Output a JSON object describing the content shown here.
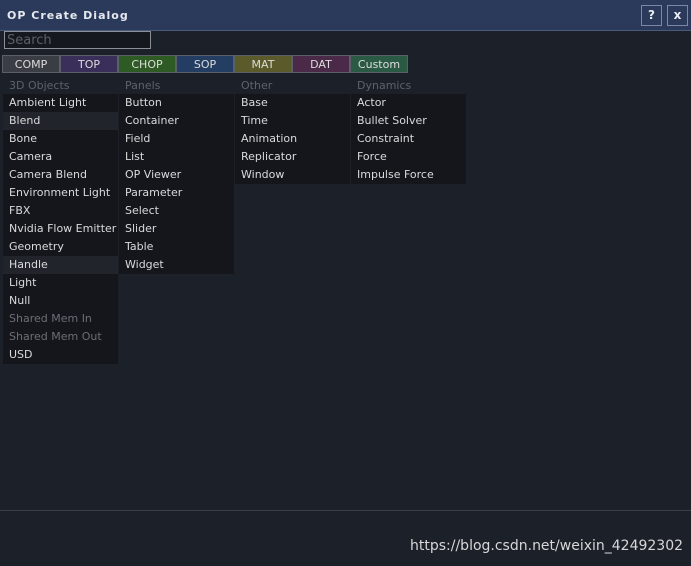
{
  "window": {
    "title": "OP Create Dialog",
    "help_label": "?",
    "close_label": "x"
  },
  "search": {
    "placeholder": "Search",
    "value": ""
  },
  "tabs": [
    {
      "label": "COMP",
      "color": "#3a3d44"
    },
    {
      "label": "TOP",
      "color": "#3a2e5a"
    },
    {
      "label": "CHOP",
      "color": "#2e5a24"
    },
    {
      "label": "SOP",
      "color": "#233e62"
    },
    {
      "label": "MAT",
      "color": "#5a5a2a"
    },
    {
      "label": "DAT",
      "color": "#4a2a48"
    },
    {
      "label": "Custom",
      "color": "#2a5a44"
    }
  ],
  "columns": [
    {
      "header": "3D Objects",
      "items": [
        "Ambient Light",
        "Blend",
        "Bone",
        "Camera",
        "Camera Blend",
        "Environment Light",
        "FBX",
        "Nvidia Flow Emitter",
        "Geometry",
        "Handle",
        "Light",
        "Null",
        "Shared Mem In",
        "Shared Mem Out",
        "USD"
      ]
    },
    {
      "header": "Panels",
      "items": [
        "Button",
        "Container",
        "Field",
        "List",
        "OP Viewer",
        "Parameter",
        "Select",
        "Slider",
        "Table",
        "Widget"
      ]
    },
    {
      "header": "Other",
      "items": [
        "Base",
        "Time",
        "Animation",
        "Replicator",
        "Window"
      ]
    },
    {
      "header": "Dynamics",
      "items": [
        "Actor",
        "Bullet Solver",
        "Constraint",
        "Force",
        "Impulse Force"
      ]
    }
  ],
  "watermark": "https://blog.csdn.net/weixin_42492302"
}
